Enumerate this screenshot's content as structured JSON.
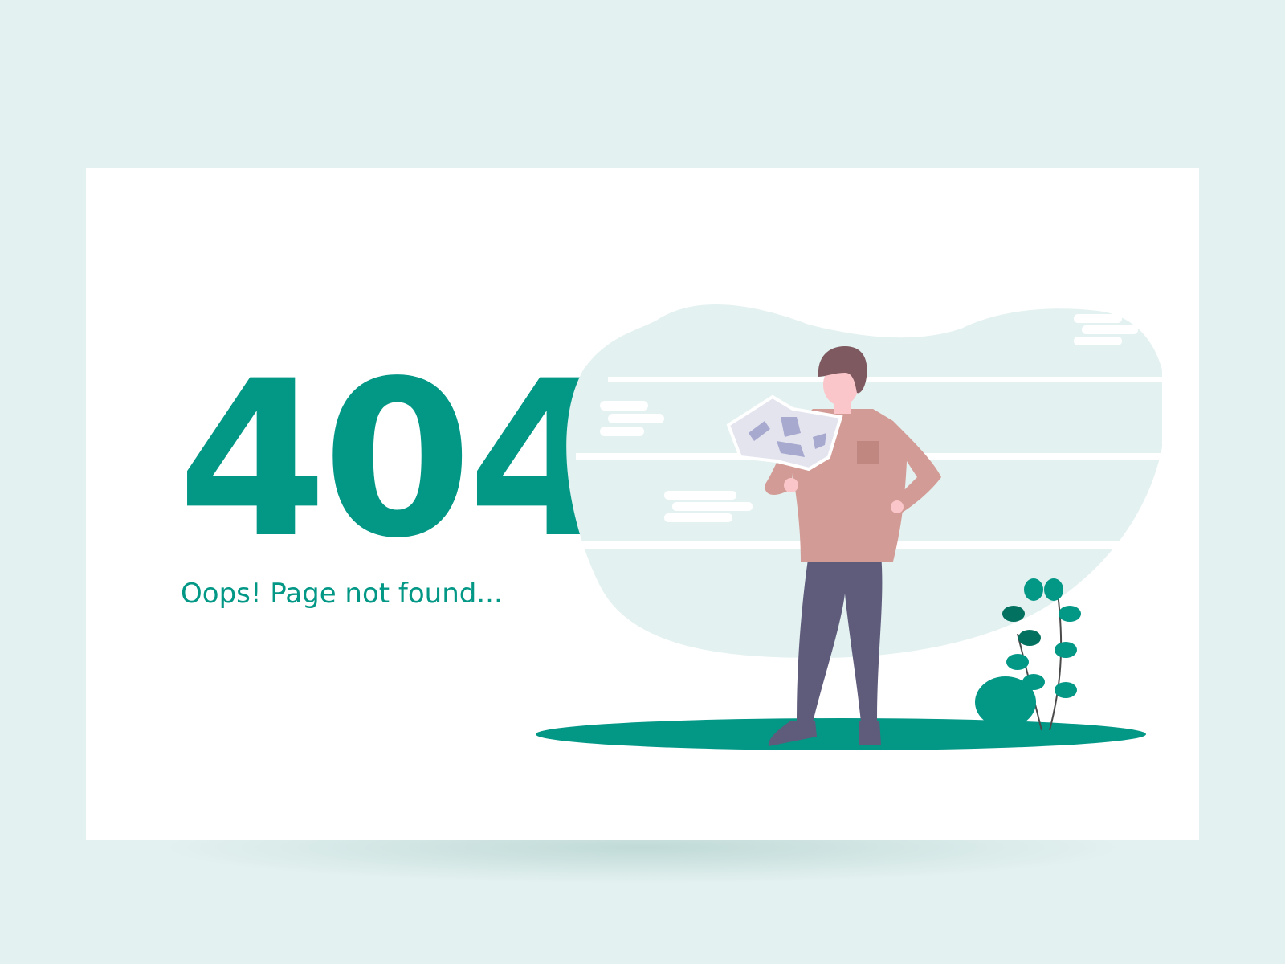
{
  "error": {
    "code": "404",
    "message": "Oops! Page not found..."
  },
  "colors": {
    "background": "#e3f1f0",
    "card": "#ffffff",
    "accent": "#039786",
    "blob": "#e3f1f0",
    "shirt": "#d39b95",
    "pants": "#5e5b7b",
    "hair": "#7e5a60",
    "skin": "#fbc6c9",
    "leaf_dark": "#03715f"
  },
  "icons": [
    "person-holding-map-illustration",
    "plant-icon",
    "cloud-icon"
  ]
}
